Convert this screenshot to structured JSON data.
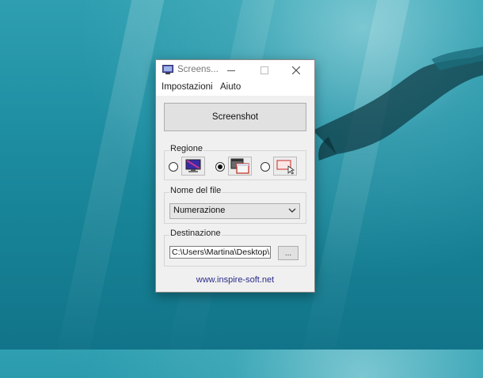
{
  "window": {
    "title": "Screens...",
    "menu": [
      "Impostazioni",
      "Aiuto"
    ]
  },
  "main": {
    "screenshot_button": "Screenshot",
    "regione": {
      "label": "Regione",
      "options": [
        {
          "icon": "fullscreen-monitor-icon",
          "selected": false
        },
        {
          "icon": "window-capture-icon",
          "selected": true
        },
        {
          "icon": "region-select-icon",
          "selected": false
        }
      ]
    },
    "nome_file": {
      "label": "Nome del file",
      "selected": "Numerazione"
    },
    "destinazione": {
      "label": "Destinazione",
      "path": "C:\\Users\\Martina\\Desktop\\",
      "browse_label": "..."
    },
    "footer_link": "www.inspire-soft.net"
  },
  "colors": {
    "window_bg": "#f0f0f0",
    "link": "#2b2b8c",
    "wallpaper": "#1f8fa3"
  }
}
